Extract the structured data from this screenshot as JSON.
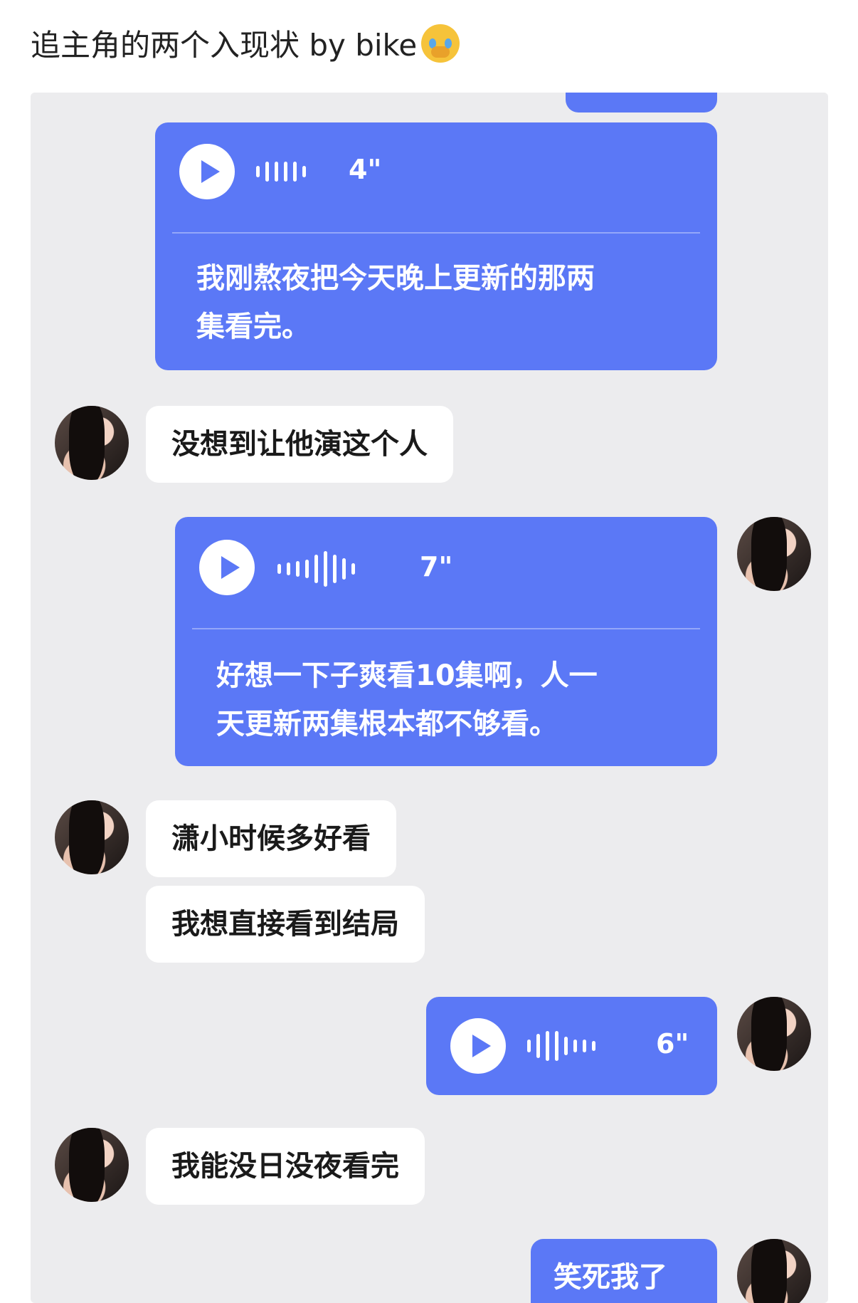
{
  "post": {
    "title": "追主角的两个入现状 by bike",
    "title_emoji": "crying-face-with-hands-over-mouth"
  },
  "colors": {
    "outgoing_bubble": "#5b78f6",
    "incoming_bubble": "#ffffff",
    "chat_background": "#ececee"
  },
  "messages": [
    {
      "type": "voice",
      "from": "me",
      "duration": "4\"",
      "transcript": [
        "我刚熬夜把今天晚上更新的那两",
        "集看完。"
      ]
    },
    {
      "type": "text",
      "from": "friend",
      "text": "没想到让他演这个人"
    },
    {
      "type": "voice",
      "from": "me",
      "duration": "7\"",
      "transcript": [
        "好想一下子爽看10集啊，人一",
        "天更新两集根本都不够看。"
      ]
    },
    {
      "type": "text",
      "from": "friend",
      "text": "潇小时候多好看"
    },
    {
      "type": "text",
      "from": "friend",
      "text": "我想直接看到结局"
    },
    {
      "type": "voice",
      "from": "me",
      "duration": "6\""
    },
    {
      "type": "text",
      "from": "friend",
      "text": "我能没日没夜看完"
    },
    {
      "type": "text",
      "from": "me",
      "text": "笑死我了"
    }
  ]
}
